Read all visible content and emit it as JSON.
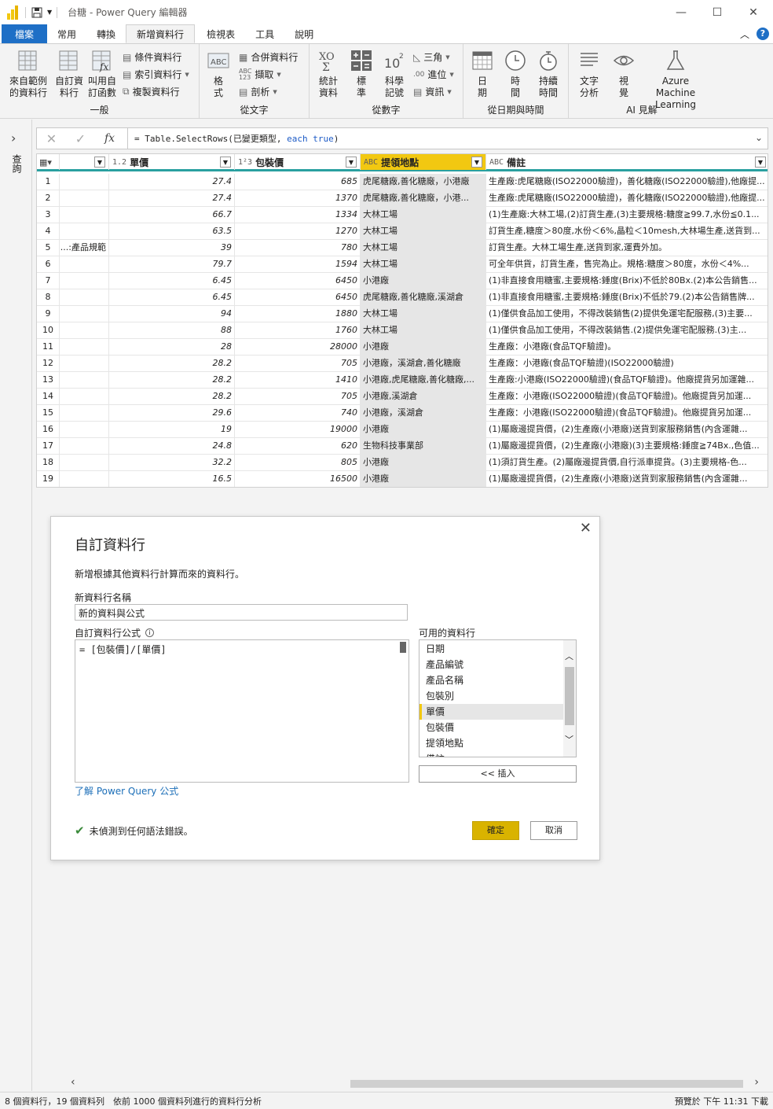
{
  "window": {
    "title": "台糖 - Power Query 編輯器"
  },
  "menu": {
    "items": [
      "檔案",
      "常用",
      "轉換",
      "新增資料行",
      "檢視表",
      "工具",
      "說明"
    ]
  },
  "ribbon": {
    "general": {
      "label": "一般",
      "example": [
        "來自範例",
        "的資料行"
      ],
      "custom": [
        "自訂資",
        "料行"
      ],
      "invoke": [
        "叫用自",
        "訂函數"
      ],
      "conditional": "條件資料行",
      "index": "索引資料行",
      "duplicate": "複製資料行"
    },
    "text": {
      "label": "從文字",
      "format": [
        "格",
        "式"
      ],
      "merge": "合併資料行",
      "extract": "擷取",
      "parse": "剖析"
    },
    "number": {
      "label": "從數字",
      "stats": [
        "統計",
        "資料"
      ],
      "standard": [
        "標",
        "準"
      ],
      "scientific": [
        "科學",
        "記號"
      ],
      "trig": "三角",
      "round": "進位",
      "info": "資訊"
    },
    "datetime": {
      "label": "從日期與時間",
      "date": [
        "日",
        "期"
      ],
      "time": [
        "時",
        "間"
      ],
      "duration": [
        "持續",
        "時間"
      ]
    },
    "ai": {
      "label": "AI 見解",
      "text_analytics": [
        "文字",
        "分析"
      ],
      "vision": [
        "視",
        "覺"
      ],
      "aml": [
        "Azure Machine",
        "Learning"
      ]
    }
  },
  "side": {
    "label": "查詢"
  },
  "formula_bar": {
    "text_pre": "= Table.SelectRows(已變更類型, ",
    "kw1": "each",
    "kw2": "true",
    "text_post": ")"
  },
  "table": {
    "headers": [
      {
        "type": "",
        "name": ""
      },
      {
        "type": "1.2",
        "name": "單價"
      },
      {
        "type": "1²3",
        "name": "包裝價"
      },
      {
        "type": "ABC",
        "name": "提領地點"
      },
      {
        "type": "ABC",
        "name": "備註"
      }
    ],
    "rows": [
      [
        "1",
        "",
        "27.4",
        "685",
        "虎尾糖廠,善化糖廠，小港廠",
        "生產廠:虎尾糖廠(ISO22000驗證)，善化糖廠(ISO22000驗證),他廠提..."
      ],
      [
        "2",
        "",
        "27.4",
        "1370",
        "虎尾糖廠,善化糖廠，小港...",
        "生產廠:虎尾糖廠(ISO22000驗證)，善化糖廠(ISO22000驗證),他廠提..."
      ],
      [
        "3",
        "",
        "66.7",
        "1334",
        "大林工場",
        "(1)生產廠:大林工場,(2)訂貨生產,(3)主要規格:糖度≧99.7,水份≦0.1..."
      ],
      [
        "4",
        "",
        "63.5",
        "1270",
        "大林工場",
        "訂貨生產,糖度＞80度,水份＜6%,晶粒＜10mesh,大林場生產,送貨到..."
      ],
      [
        "5",
        "產品規範:...",
        "39",
        "780",
        "大林工場",
        "訂貨生產。大林工場生產,送貨到家,運費外加。"
      ],
      [
        "6",
        "",
        "79.7",
        "1594",
        "大林工場",
        "可全年供貨，訂貨生產，售完為止。規格:糖度＞80度，水份＜4%..."
      ],
      [
        "7",
        "",
        "6.45",
        "6450",
        "小港廠",
        "(1)非直接食用糖蜜,主要規格:錘度(Brix)不低於80Bx.(2)本公告銷售..."
      ],
      [
        "8",
        "",
        "6.45",
        "6450",
        "虎尾糖廠,善化糖廠,溪湖倉",
        "(1)非直接食用糖蜜,主要規格:錘度(Brix)不低於79.(2)本公告銷售牌..."
      ],
      [
        "9",
        "",
        "94",
        "1880",
        "大林工場",
        "(1)僅供食品加工使用，不得改裝銷售(2)提供免運宅配服務,(3)主要..."
      ],
      [
        "10",
        "",
        "88",
        "1760",
        "大林工場",
        "(1)僅供食品加工使用，不得改裝銷售.(2)提供免運宅配服務.(3)主..."
      ],
      [
        "11",
        "",
        "28",
        "28000",
        "小港廠",
        "生產廠：小港廠(食品TQF驗證)。"
      ],
      [
        "12",
        "",
        "28.2",
        "705",
        "小港廠，溪湖倉,善化糖廠",
        "生產廠：小港廠(食品TQF驗證)(ISO22000驗證)"
      ],
      [
        "13",
        "",
        "28.2",
        "1410",
        "小港廠,虎尾糖廠,善化糖廠,...",
        "生產廠:小港廠(ISO22000驗證)(食品TQF驗證)。他廠提貨另加運雜..."
      ],
      [
        "14",
        "",
        "28.2",
        "705",
        "小港廠,溪湖倉",
        "生產廠：小港廠(ISO22000驗證)(食品TQF驗證)。他廠提貨另加運..."
      ],
      [
        "15",
        "",
        "29.6",
        "740",
        "小港廠，溪湖倉",
        "生產廠：小港廠(ISO22000驗證)(食品TQF驗證)。他廠提貨另加運..."
      ],
      [
        "16",
        "",
        "19",
        "19000",
        "小港廠",
        "(1)屬廠邊提貨價，(2)生產廠(小港廠)送貨到家服務銷售(內含運雜..."
      ],
      [
        "17",
        "",
        "24.8",
        "620",
        "生物科技事業部",
        "(1)屬廠邊提貨價，(2)生產廠(小港廠)(3)主要規格:錘度≧74Bx.,色值..."
      ],
      [
        "18",
        "",
        "32.2",
        "805",
        "小港廠",
        "(1)須訂貨生產。(2)屬廠邊提貨價,自行派車提貨。(3)主要規格-色..."
      ],
      [
        "19",
        "",
        "16.5",
        "16500",
        "小港廠",
        "(1)屬廠邊提貨價，(2)生產廠(小港廠)送貨到家服務銷售(內含運雜..."
      ]
    ]
  },
  "dialog": {
    "title": "自訂資料行",
    "subtitle": "新增根據其他資料行計算而來的資料行。",
    "name_label": "新資料行名稱",
    "name_value": "新的資料與公式",
    "formula_label": "自訂資料行公式",
    "formula_value": "= [包裝價]/[單價]",
    "available_label": "可用的資料行",
    "columns": [
      "日期",
      "產品編號",
      "產品名稱",
      "包裝別",
      "單價",
      "包裝價",
      "提領地點",
      "備註"
    ],
    "selected_column": "單價",
    "insert_label": "<< 插入",
    "learn_link": "了解 Power Query 公式",
    "status": "未偵測到任何語法錯誤。",
    "ok_label": "確定",
    "cancel_label": "取消"
  },
  "statusbar": {
    "left": "8 個資料行，19 個資料列　依前 1000 個資料列進行的資料行分析",
    "right": "預覽於 下午 11:31 下載"
  },
  "colors": {
    "accent": "#f2c811",
    "file_tab": "#1e6fc6",
    "ok_button": "#d9b300",
    "header_underline": "#29a0a0"
  }
}
